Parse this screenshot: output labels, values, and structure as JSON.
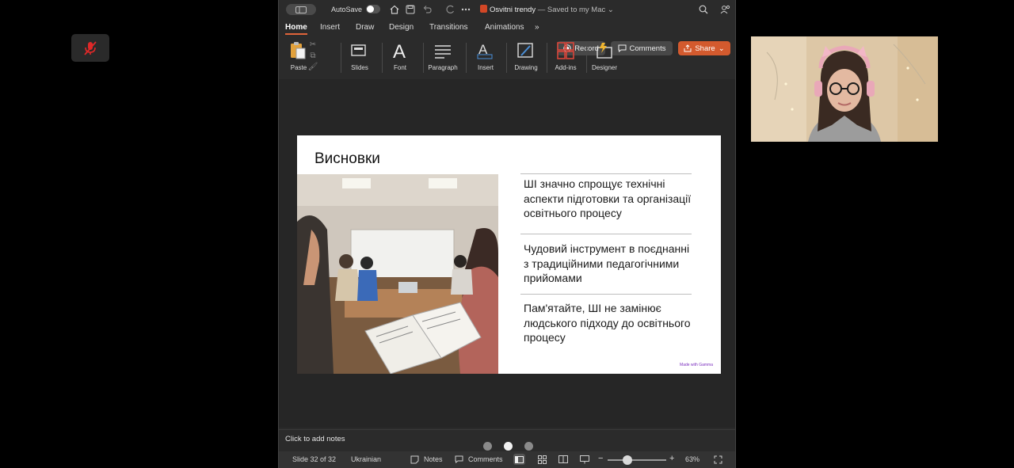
{
  "colors": {
    "accent": "#d35a2e",
    "record_dot": "#ffffff",
    "mic_muted": "#e02828",
    "window_bg": "#2b2b2b",
    "slide_bg": "#ffffff"
  },
  "meeting": {
    "mic_icon": "microphone-muted-icon"
  },
  "titlebar": {
    "autosave_label": "AutoSave",
    "autosave_on": false,
    "doc_name": "Osvitni trendy",
    "doc_status": "— Saved to my Mac",
    "icons": [
      "sidebar-icon",
      "home-icon",
      "save-icon",
      "undo-icon",
      "redo-icon",
      "more-icon",
      "search-icon",
      "share-people-icon"
    ]
  },
  "ribbon": {
    "tabs": [
      "Home",
      "Insert",
      "Draw",
      "Design",
      "Transitions",
      "Animations"
    ],
    "active_tab": "Home",
    "overflow": "»",
    "record_label": "Record",
    "comments_label": "Comments",
    "share_label": "Share"
  },
  "toolbar": {
    "paste": "Paste",
    "slides": "Slides",
    "font": "Font",
    "paragraph": "Paragraph",
    "insert": "Insert",
    "drawing": "Drawing",
    "addins": "Add-ins",
    "designer": "Designer"
  },
  "slide": {
    "title": "Висновки",
    "points": [
      "ШІ значно спрощує технічні аспекти підготовки та організації освітнього процесу",
      "Чудовий інструмент в поєднанні з традиційними педагогічними прийомами",
      "Пам'ятайте, ШІ не замінює людського підходу до освітнього процесу"
    ],
    "badge": "Made with Gamma"
  },
  "notes": {
    "placeholder": "Click to add notes"
  },
  "status": {
    "slide_info": "Slide 32 of 32",
    "language": "Ukrainian",
    "notes_label": "Notes",
    "comments_label": "Comments",
    "zoom": "63%",
    "zoom_fraction": 0.35
  },
  "carousel": {
    "count": 3,
    "active": 2
  }
}
